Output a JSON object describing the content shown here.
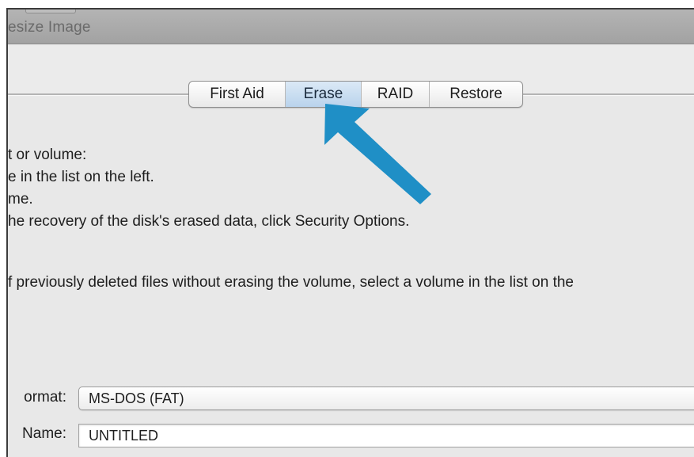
{
  "window": {
    "title": "esize Image"
  },
  "tabs": [
    {
      "label": "First Aid",
      "active": false
    },
    {
      "label": "Erase",
      "active": true
    },
    {
      "label": "RAID",
      "active": false
    },
    {
      "label": "Restore",
      "active": false
    }
  ],
  "instructions": {
    "line1": "t or volume:",
    "line2": "e in the list on the left.",
    "line3": "me.",
    "line4": "he recovery of the disk's erased data, click Security Options.",
    "line5": "f previously deleted files without erasing the volume, select a volume in the list on the"
  },
  "form": {
    "format_label": "ormat:",
    "format_value": "MS-DOS (FAT)",
    "name_label": "Name:",
    "name_value": "UNTITLED"
  },
  "colors": {
    "arrow": "#1f8fc6",
    "active_tab": "#c4dbef"
  },
  "icons": {
    "pointer_arrow": "arrow-annotation"
  }
}
